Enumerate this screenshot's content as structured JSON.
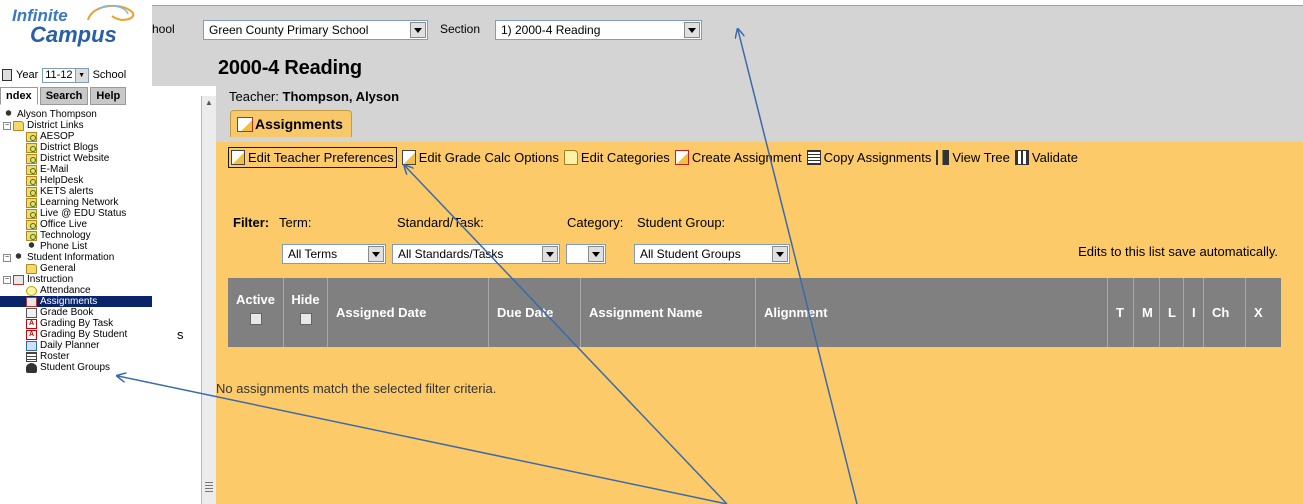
{
  "logo": {
    "line1": "Infinite",
    "line2": "Campus"
  },
  "sidebar": {
    "year_label": "Year",
    "year_value": "11-12",
    "school_label": "School",
    "tabs": [
      "ndex",
      "Search",
      "Help"
    ],
    "tree": [
      {
        "label": "Alyson Thompson",
        "icon": "person-icon",
        "depth": 0
      },
      {
        "label": "District Links",
        "icon": "folder-icon",
        "depth": 0,
        "expander": "−"
      },
      {
        "label": "AESOP",
        "icon": "link-icon",
        "depth": 2
      },
      {
        "label": "District Blogs",
        "icon": "link-icon",
        "depth": 2
      },
      {
        "label": "District Website",
        "icon": "link-icon",
        "depth": 2
      },
      {
        "label": "E-Mail",
        "icon": "link-icon",
        "depth": 2
      },
      {
        "label": "HelpDesk",
        "icon": "link-icon",
        "depth": 2
      },
      {
        "label": "KETS alerts",
        "icon": "link-icon",
        "depth": 2
      },
      {
        "label": "Learning Network",
        "icon": "link-icon",
        "depth": 2
      },
      {
        "label": "Live @ EDU Status",
        "icon": "link-icon",
        "depth": 2
      },
      {
        "label": "Office Live",
        "icon": "link-icon",
        "depth": 2
      },
      {
        "label": "Technology",
        "icon": "link-icon",
        "depth": 2
      },
      {
        "label": "Phone List",
        "icon": "person-icon",
        "depth": 2
      },
      {
        "label": "Student Information",
        "icon": "person-icon",
        "depth": 0,
        "expander": "−"
      },
      {
        "label": "General",
        "icon": "folder-icon",
        "depth": 2
      },
      {
        "label": "Instruction",
        "icon": "book-icon",
        "depth": 0,
        "expander": "−"
      },
      {
        "label": "Attendance",
        "icon": "attendance-icon",
        "depth": 2
      },
      {
        "label": "Assignments",
        "icon": "assignments-icon",
        "depth": 2,
        "selected": true
      },
      {
        "label": "Grade Book",
        "icon": "grade-book-icon",
        "depth": 2
      },
      {
        "label": "Grading By Task",
        "icon": "grading-task-icon",
        "depth": 2
      },
      {
        "label": "Grading By Student",
        "icon": "grading-task-icon",
        "depth": 2
      },
      {
        "label": "Daily Planner",
        "icon": "planner-icon",
        "depth": 2
      },
      {
        "label": "Roster",
        "icon": "roster-icon",
        "depth": 2
      },
      {
        "label": "Student Groups",
        "icon": "groups-icon",
        "depth": 2
      }
    ]
  },
  "top": {
    "school_label": "hool",
    "school_value": "Green County Primary School",
    "section_label": "Section",
    "section_value": "1) 2000-4 Reading"
  },
  "page": {
    "title": "2000-4 Reading",
    "teacher_label": "Teacher:",
    "teacher_name": "Thompson, Alyson",
    "tab": "Assignments",
    "stray": "s"
  },
  "toolbar": [
    {
      "label": "Edit Teacher Preferences",
      "icon": "pencil-icon",
      "name": "edit-teacher-preferences-button"
    },
    {
      "label": "Edit Grade Calc Options",
      "icon": "pencil-icon",
      "name": "edit-grade-calc-options-button"
    },
    {
      "label": "Edit Categories",
      "icon": "folder-icon",
      "name": "edit-categories-button"
    },
    {
      "label": "Create Assignment",
      "icon": "create-icon",
      "name": "create-assignment-button"
    },
    {
      "label": "Copy Assignments",
      "icon": "copy-icon",
      "name": "copy-assignments-button"
    },
    {
      "label": "View Tree",
      "icon": "tree-icon",
      "name": "view-tree-button"
    },
    {
      "label": "Validate",
      "icon": "validate-icon",
      "name": "validate-button"
    }
  ],
  "filters": {
    "filter_label": "Filter:",
    "term_label": "Term:",
    "standard_label": "Standard/Task:",
    "category_label": "Category:",
    "group_label": "Student Group:",
    "term_value": "All Terms",
    "standard_value": "All Standards/Tasks",
    "category_value": "",
    "group_value": "All Student Groups",
    "autosave_note": "Edits to this list save automatically."
  },
  "grid": {
    "columns": [
      "Active",
      "Hide",
      "Assigned Date",
      "Due Date",
      "Assignment Name",
      "Alignment",
      "T",
      "M",
      "L",
      "I",
      "Ch",
      "X"
    ],
    "empty_message": "No assignments match the selected filter criteria."
  },
  "colors": {
    "content_bg": "#fdca6a",
    "header_gray": "#d4d4d4",
    "grid_header": "#808080",
    "selection": "#0a246a",
    "arrow": "#3b6aa8"
  }
}
